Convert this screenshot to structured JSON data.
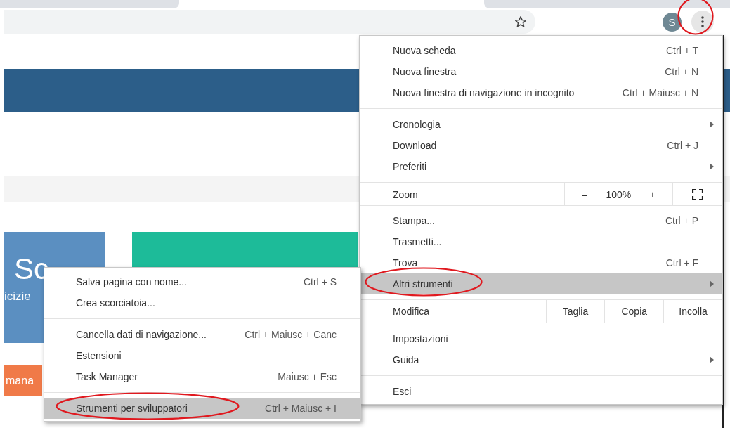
{
  "toolbar": {
    "avatar": "S",
    "menu_circled": true
  },
  "page": {
    "card_title": "Sc",
    "card_subtitle": "icizie",
    "button_label": "mana"
  },
  "menu": {
    "items": [
      {
        "kind": "item",
        "label": "Nuova scheda",
        "shortcut": "Ctrl + T",
        "submenu": false,
        "selected": false,
        "circled": false
      },
      {
        "kind": "item",
        "label": "Nuova finestra",
        "shortcut": "Ctrl + N",
        "submenu": false,
        "selected": false,
        "circled": false
      },
      {
        "kind": "item",
        "label": "Nuova finestra di navigazione in incognito",
        "shortcut": "Ctrl + Maiusc + N",
        "submenu": false,
        "selected": false,
        "circled": false
      },
      {
        "kind": "separator"
      },
      {
        "kind": "item",
        "label": "Cronologia",
        "submenu": true,
        "selected": false,
        "circled": false
      },
      {
        "kind": "item",
        "label": "Download",
        "shortcut": "Ctrl + J",
        "submenu": false,
        "selected": false,
        "circled": false
      },
      {
        "kind": "item",
        "label": "Preferiti",
        "submenu": true,
        "selected": false,
        "circled": false
      },
      {
        "kind": "separator"
      },
      {
        "kind": "zoom",
        "label": "Zoom",
        "minus": "–",
        "value": "100%",
        "plus": "+"
      },
      {
        "kind": "item",
        "label": "Stampa...",
        "shortcut": "Ctrl + P",
        "submenu": false,
        "selected": false,
        "circled": false
      },
      {
        "kind": "item",
        "label": "Trasmetti...",
        "submenu": false,
        "selected": false,
        "circled": false
      },
      {
        "kind": "item",
        "label": "Trova",
        "shortcut": "Ctrl + F",
        "submenu": false,
        "selected": false,
        "circled": false
      },
      {
        "kind": "item",
        "label": "Altri strumenti",
        "submenu": true,
        "selected": true,
        "circled": true
      },
      {
        "kind": "separator"
      },
      {
        "kind": "edit",
        "label": "Modifica",
        "buttons": [
          "Taglia",
          "Copia",
          "Incolla"
        ]
      },
      {
        "kind": "item",
        "label": "Impostazioni",
        "submenu": false,
        "selected": false,
        "circled": false
      },
      {
        "kind": "item",
        "label": "Guida",
        "submenu": true,
        "selected": false,
        "circled": false
      },
      {
        "kind": "separator"
      },
      {
        "kind": "item",
        "label": "Esci",
        "submenu": false,
        "selected": false,
        "circled": false
      }
    ]
  },
  "submenu": {
    "items": [
      {
        "kind": "item",
        "label": "Salva pagina con nome...",
        "shortcut": "Ctrl + S",
        "submenu": false,
        "selected": false,
        "circled": false
      },
      {
        "kind": "item",
        "label": "Crea scorciatoia...",
        "submenu": false,
        "selected": false,
        "circled": false
      },
      {
        "kind": "separator"
      },
      {
        "kind": "item",
        "label": "Cancella dati di navigazione...",
        "shortcut": "Ctrl + Maiusc + Canc",
        "submenu": false,
        "selected": false,
        "circled": false
      },
      {
        "kind": "item",
        "label": "Estensioni",
        "submenu": false,
        "selected": false,
        "circled": false
      },
      {
        "kind": "item",
        "label": "Task Manager",
        "shortcut": "Maiusc + Esc",
        "submenu": false,
        "selected": false,
        "circled": false
      },
      {
        "kind": "separator"
      },
      {
        "kind": "item",
        "label": "Strumenti per sviluppatori",
        "shortcut": "Ctrl + Maiusc + I",
        "submenu": false,
        "selected": true,
        "circled": true
      }
    ]
  }
}
